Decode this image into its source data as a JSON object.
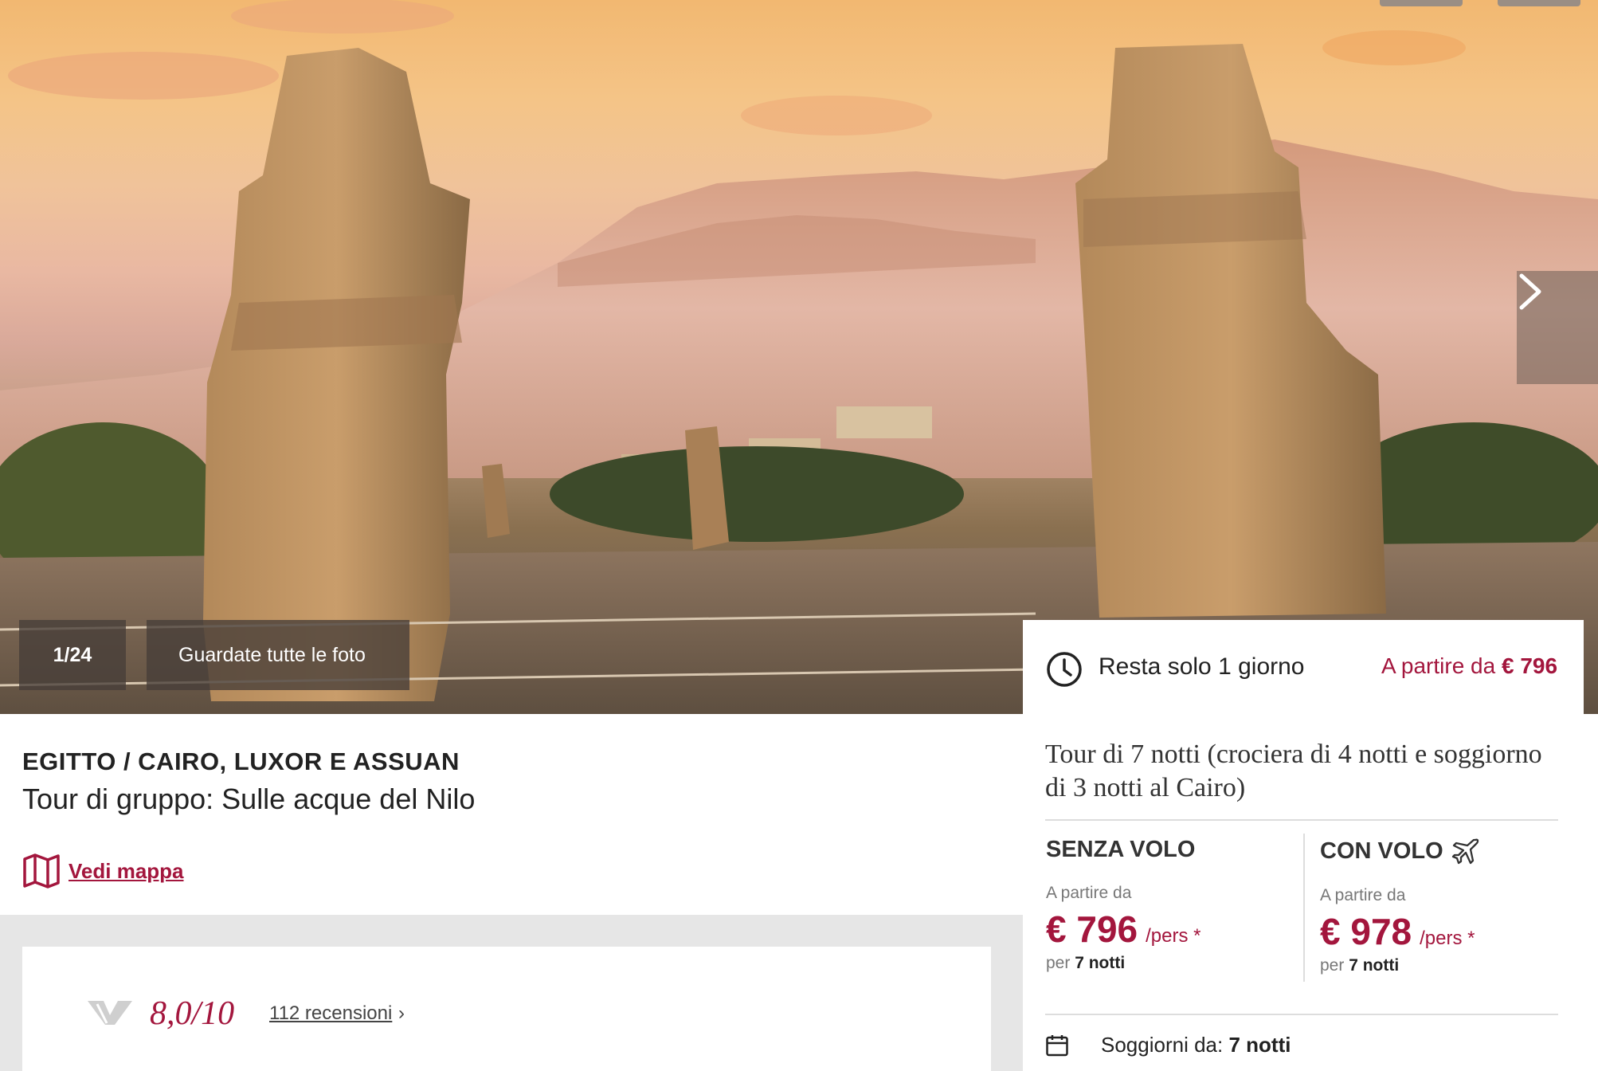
{
  "gallery": {
    "counter": "1/24",
    "all_photos_label": "Guardate tutte le foto",
    "next_icon": "chevron-right-icon"
  },
  "trip": {
    "destination": "EGITTO / CAIRO, LUXOR E ASSUAN",
    "subtitle": "Tour di gruppo: Sulle acque del Nilo",
    "map_label": "Vedi mappa"
  },
  "reviews": {
    "score": "8,0/10",
    "count_label": "112 recensioni",
    "chevron": "›"
  },
  "offer": {
    "remaining": "Resta solo 1 giorno",
    "from_prefix": "A partire da",
    "from_price": "€ 796",
    "title": "Tour di 7 notti (crociera di 4 notti e soggiorno di 3 notti al Cairo)",
    "options": [
      {
        "heading": "SENZA VOLO",
        "from": "A partire da",
        "price": "€ 796",
        "unit": "/pers *",
        "per": "per",
        "nights": "7 notti",
        "icon": ""
      },
      {
        "heading": "CON VOLO",
        "from": "A partire da",
        "price": "€ 978",
        "unit": "/pers *",
        "per": "per",
        "nights": "7 notti",
        "icon": "airplane-icon"
      }
    ],
    "stay_label": "Soggiorni da:",
    "stay_value": "7 notti"
  },
  "colors": {
    "accent": "#a3163d",
    "text": "#222222",
    "overlay": "#463e38"
  }
}
